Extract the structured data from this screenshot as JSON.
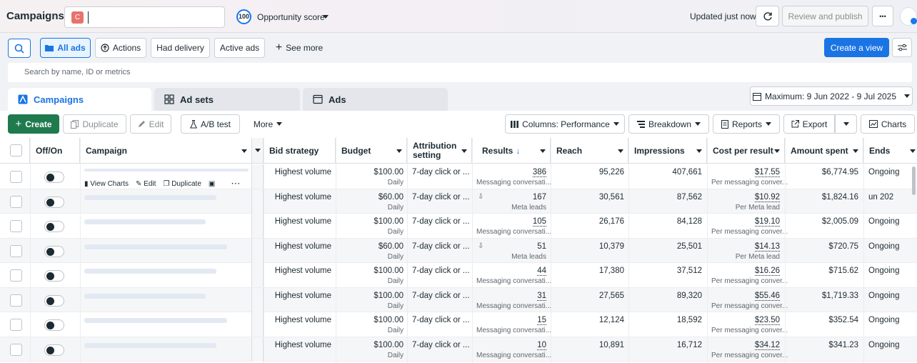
{
  "header": {
    "title": "Campaigns",
    "account_badge": "C",
    "opportunity_score": "100",
    "opportunity_label": "Opportunity score",
    "updated_text": "Updated just now",
    "review_publish": "Review and publish",
    "more_dots": "•••"
  },
  "filters": {
    "all_ads": "All ads",
    "actions": "Actions",
    "had_delivery": "Had delivery",
    "active_ads": "Active ads",
    "see_more": "See more",
    "create_view": "Create a view"
  },
  "search": {
    "placeholder": "Search by name, ID or metrics"
  },
  "tabs": [
    {
      "label": "Campaigns"
    },
    {
      "label": "Ad sets"
    },
    {
      "label": "Ads"
    }
  ],
  "date_range": "Maximum: 9 Jun 2022 - 9 Jul 2025",
  "toolbar": {
    "create": "Create",
    "duplicate": "Duplicate",
    "edit": "Edit",
    "ab_test": "A/B test",
    "more": "More",
    "columns": "Columns: Performance",
    "breakdown": "Breakdown",
    "reports": "Reports",
    "export": "Export",
    "charts": "Charts"
  },
  "columns": {
    "off_on": "Off/On",
    "campaign": "Campaign",
    "bid_strategy": "Bid strategy",
    "budget": "Budget",
    "attribution": "Attribution setting",
    "results": "Results",
    "reach": "Reach",
    "impressions": "Impressions",
    "cost_per_result": "Cost per result",
    "amount_spent": "Amount spent",
    "ends": "Ends"
  },
  "row_actions": {
    "view_charts": "View Charts",
    "edit": "Edit",
    "duplicate": "Duplicate"
  },
  "rows": [
    {
      "bid": "Highest volume",
      "budget": "$100.00",
      "budget_sub": "Daily",
      "attr": "7-day click or ...",
      "results": "386",
      "results_sub": "Messaging conversati...",
      "reach": "95,226",
      "impressions": "407,661",
      "cpr": "$17.55",
      "cpr_sub": "Per messaging conver...",
      "spent": "$6,774.95",
      "ends": "Ongoing"
    },
    {
      "bid": "Highest volume",
      "budget": "$60.00",
      "budget_sub": "Daily",
      "attr": "7-day click or ...",
      "results": "167",
      "results_sub": "Meta leads",
      "reach": "30,561",
      "impressions": "87,562",
      "cpr": "$10.92",
      "cpr_sub": "Per Meta lead",
      "spent": "$1,824.16",
      "ends": "un 202"
    },
    {
      "bid": "Highest volume",
      "budget": "$100.00",
      "budget_sub": "Daily",
      "attr": "7-day click or ...",
      "results": "105",
      "results_sub": "Messaging conversati...",
      "reach": "26,176",
      "impressions": "84,128",
      "cpr": "$19.10",
      "cpr_sub": "Per messaging conver...",
      "spent": "$2,005.09",
      "ends": "Ongoing"
    },
    {
      "bid": "Highest volume",
      "budget": "$60.00",
      "budget_sub": "Daily",
      "attr": "7-day click or ...",
      "results": "51",
      "results_sub": "Meta leads",
      "reach": "10,379",
      "impressions": "25,501",
      "cpr": "$14.13",
      "cpr_sub": "Per Meta lead",
      "spent": "$720.75",
      "ends": "Ongoing"
    },
    {
      "bid": "Highest volume",
      "budget": "$100.00",
      "budget_sub": "Daily",
      "attr": "7-day click or ...",
      "results": "44",
      "results_sub": "Messaging conversati...",
      "reach": "17,380",
      "impressions": "37,512",
      "cpr": "$16.26",
      "cpr_sub": "Per messaging conver...",
      "spent": "$715.62",
      "ends": "Ongoing"
    },
    {
      "bid": "Highest volume",
      "budget": "$100.00",
      "budget_sub": "Daily",
      "attr": "7-day click or ...",
      "results": "31",
      "results_sub": "Messaging conversati...",
      "reach": "27,565",
      "impressions": "89,320",
      "cpr": "$55.46",
      "cpr_sub": "Per messaging conver...",
      "spent": "$1,719.33",
      "ends": "Ongoing"
    },
    {
      "bid": "Highest volume",
      "budget": "$100.00",
      "budget_sub": "Daily",
      "attr": "7-day click or ...",
      "results": "15",
      "results_sub": "Messaging conversati...",
      "reach": "12,124",
      "impressions": "18,592",
      "cpr": "$23.50",
      "cpr_sub": "Per messaging conver...",
      "spent": "$352.54",
      "ends": "Ongoing"
    },
    {
      "bid": "Highest volume",
      "budget": "$100.00",
      "budget_sub": "Daily",
      "attr": "7-day click or ...",
      "results": "10",
      "results_sub": "Messaging conversati...",
      "reach": "10,891",
      "impressions": "16,712",
      "cpr": "$34.12",
      "cpr_sub": "Per messaging conver...",
      "spent": "$341.23",
      "ends": "Ongoing"
    }
  ]
}
